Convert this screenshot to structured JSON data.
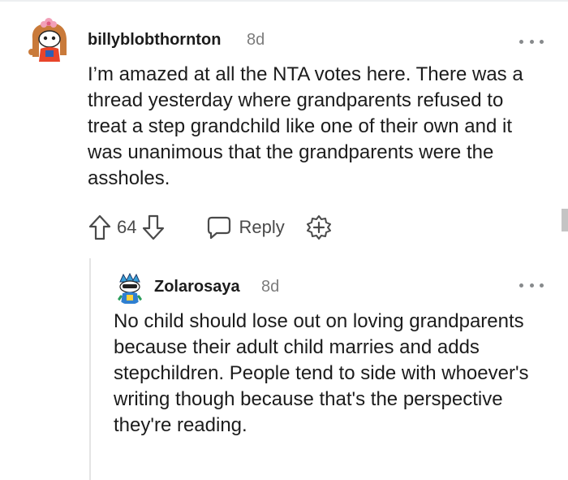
{
  "comment": {
    "username": "billyblobthornton",
    "age": "8d",
    "body": "I’m amazed at all the NTA votes here. There was a thread yesterday where grandparents refused to treat a step grandchild like one of their own and it was unanimous that the grandparents were the assholes.",
    "score": "64",
    "reply_label": "Reply"
  },
  "reply": {
    "username": "Zolarosaya",
    "age": "8d",
    "body": "No child should lose out on loving grandparents because their adult child marries and adds stepchildren. People tend to side with whoever's writing though because that's the perspective they're reading."
  },
  "colors": {
    "text": "#1c1c1c",
    "meta": "#7c7c7c",
    "icon": "#4a4a4a",
    "thread_line": "#e4e4e4"
  }
}
